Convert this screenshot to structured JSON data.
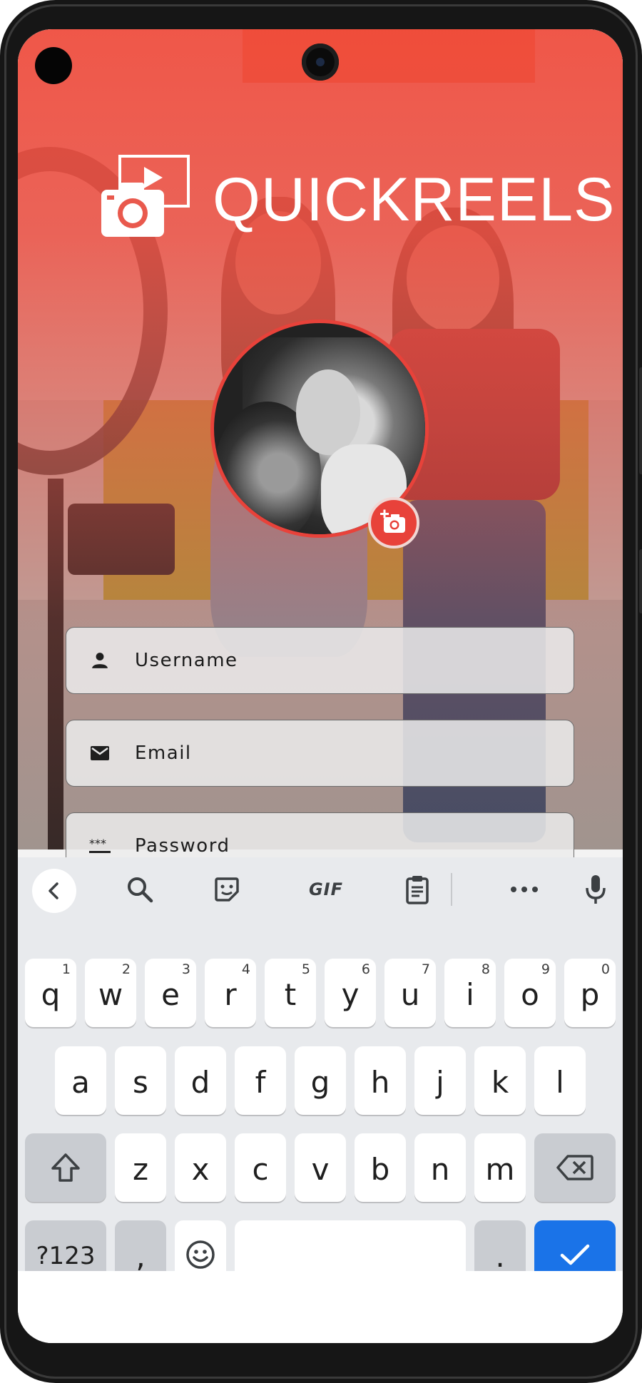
{
  "app": {
    "brand_name": "QUICKREELS",
    "accent_color": "#e8423a"
  },
  "avatar": {
    "add_photo_icon": "add-a-photo-icon"
  },
  "form": {
    "username": {
      "placeholder": "Username",
      "icon": "person-icon"
    },
    "email": {
      "placeholder": "Email",
      "icon": "email-icon"
    },
    "password": {
      "placeholder": "Password",
      "icon": "password-icon"
    }
  },
  "keyboard": {
    "toolbar": [
      "back-icon",
      "search-icon",
      "sticker-icon",
      "GIF",
      "clipboard-icon",
      "more-icon",
      "mic-icon"
    ],
    "row1": [
      {
        "k": "q",
        "h": "1"
      },
      {
        "k": "w",
        "h": "2"
      },
      {
        "k": "e",
        "h": "3"
      },
      {
        "k": "r",
        "h": "4"
      },
      {
        "k": "t",
        "h": "5"
      },
      {
        "k": "y",
        "h": "6"
      },
      {
        "k": "u",
        "h": "7"
      },
      {
        "k": "i",
        "h": "8"
      },
      {
        "k": "o",
        "h": "9"
      },
      {
        "k": "p",
        "h": "0"
      }
    ],
    "row2": [
      "a",
      "s",
      "d",
      "f",
      "g",
      "h",
      "j",
      "k",
      "l"
    ],
    "row3": [
      "z",
      "x",
      "c",
      "v",
      "b",
      "n",
      "m"
    ],
    "symbols_label": "?123",
    "comma": ",",
    "period": "."
  }
}
